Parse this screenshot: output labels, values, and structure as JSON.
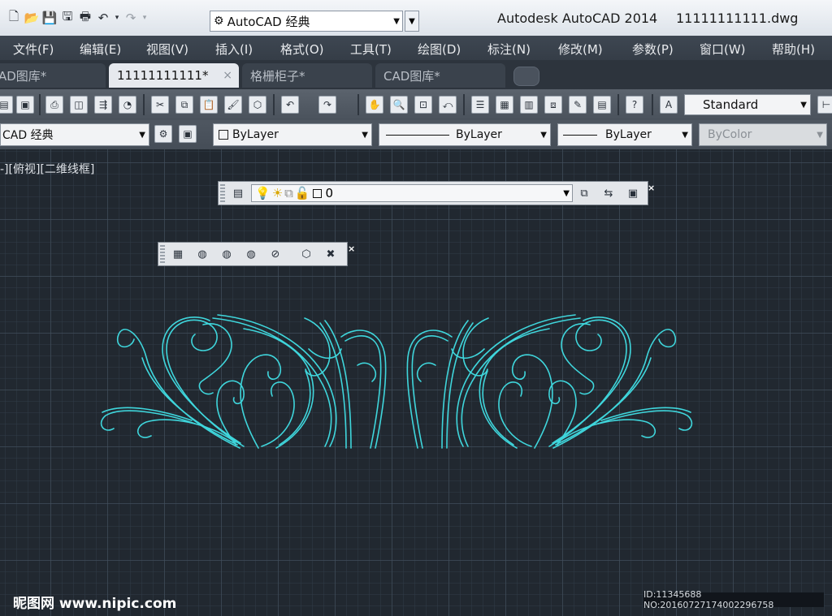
{
  "window": {
    "app_title": "Autodesk AutoCAD 2014",
    "file_title": "11111111111.dwg",
    "workspace": "AutoCAD 经典",
    "quick_access": [
      "new-icon",
      "open-icon",
      "save-icon",
      "saveas-icon",
      "plot-icon",
      "undo-icon",
      "redo-icon"
    ]
  },
  "menu": [
    "文件(F)",
    "编辑(E)",
    "视图(V)",
    "插入(I)",
    "格式(O)",
    "工具(T)",
    "绘图(D)",
    "标注(N)",
    "修改(M)",
    "参数(P)",
    "窗口(W)",
    "帮助(H)"
  ],
  "tabs": [
    {
      "label": "AD图库*",
      "active": false
    },
    {
      "label": "11111111111*",
      "active": true,
      "close": "×"
    },
    {
      "label": "格栅柜子*",
      "active": false
    },
    {
      "label": "CAD图库*",
      "active": false
    }
  ],
  "standard_toolbar": {
    "text_style": "Standard",
    "icons": [
      "open-icon",
      "save-icon",
      "print-icon",
      "plot-preview-icon",
      "publish-icon",
      "3d-dwf-icon",
      "cut-icon",
      "copy-icon",
      "paste-icon",
      "match-properties-icon",
      "block-editor-icon",
      "undo-icon",
      "redo-icon",
      "pan-icon",
      "zoom-realtime-icon",
      "zoom-window-icon",
      "zoom-previous-icon",
      "properties-icon",
      "design-center-icon",
      "tool-palettes-icon",
      "sheet-set-icon",
      "markup-icon",
      "quickcalc-icon",
      "help-icon",
      "text-style-icon"
    ]
  },
  "properties_toolbar": {
    "workspace": "CAD 经典",
    "color": "ByLayer",
    "linetype": "ByLayer",
    "lineweight": "ByLayer",
    "plotstyle": "ByColor"
  },
  "viewport_label": "-][俯视][二维线框]",
  "layer_toolbar": {
    "current_layer": "0"
  },
  "watermark": {
    "left": "昵图网 www.nipic.com",
    "right": "ID:11345688 NO:20160727174002296758"
  },
  "colors": {
    "drawing_line": "#3fd6dc",
    "canvas_bg": "#212830",
    "menubar": "#3a424c"
  }
}
